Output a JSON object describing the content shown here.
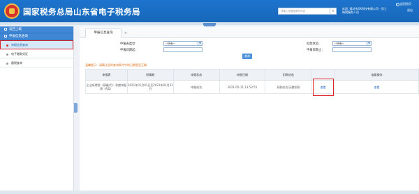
{
  "header": {
    "title": "国家税务总局山东省电子税务局",
    "search_placeholder": "请输入您要搜索的内容",
    "search_icon": "search-icon",
    "user_line1": "欢迎, 潍坊市XX科技有限公司 · 员工",
    "user_line2": "纳税服务人员",
    "logout": "退出",
    "home": "返回首页"
  },
  "sidebar": {
    "sections": [
      {
        "label": "返回上级"
      },
      {
        "label": "申报信息查询"
      }
    ],
    "items": [
      {
        "label": "申报信息查询",
        "active": true
      },
      {
        "label": "电子缴款凭证",
        "active": false
      },
      {
        "label": "缴税查询",
        "active": false
      }
    ]
  },
  "main": {
    "tab": {
      "label": "申报信息查询"
    },
    "filters": {
      "tax_type_label": "申报表类型:",
      "tax_type_value": "--所有--",
      "start_date_label": "申报日期起:",
      "status_label": "扣款状态:",
      "status_value": "--所有--",
      "end_date_label": "申报日期止:"
    },
    "query_button": "查询",
    "tip": "温馨提示：请确认您的查询条件中的日期是否正确",
    "table": {
      "headers": [
        "申报表",
        "所属期",
        "申报状态",
        "申报日期",
        "扣款状态",
        "",
        "查看操作"
      ],
      "rows": [
        {
          "form": "企业所得税（预缴/月）季度申报表（A类）",
          "period": "2021年01月01日至2021年03月31日",
          "status": "申报成功",
          "date": "2021-05-11 13:53:55",
          "deduct": "扣款成功/无需扣款",
          "view": "查看",
          "action": "查看"
        }
      ]
    }
  },
  "colors": {
    "header": "#1d74cc",
    "accent": "#4a90dc",
    "highlight": "#e02424",
    "tip": "#e0701a"
  }
}
